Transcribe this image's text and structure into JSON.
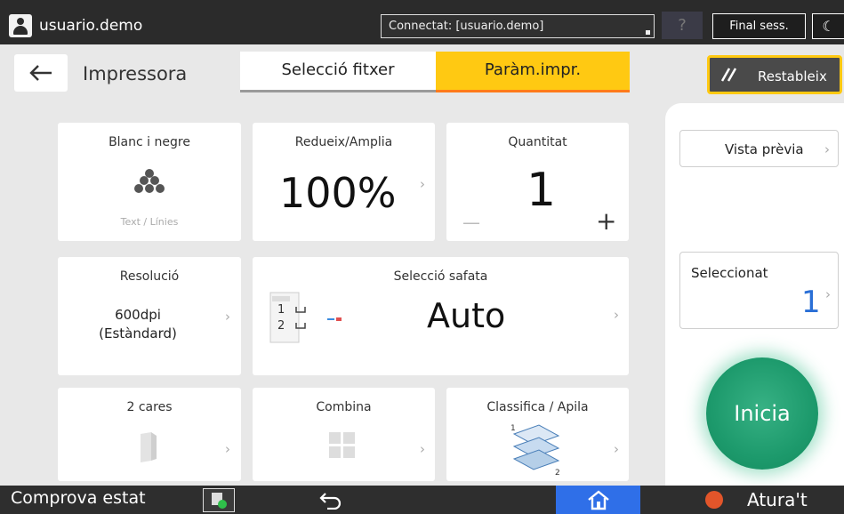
{
  "topbar": {
    "username": "usuario.demo",
    "connection": "Connectat: [usuario.demo]",
    "help": "?",
    "logout": "Final sess."
  },
  "header": {
    "title": "Impressora",
    "tabs": [
      {
        "label": "Selecció fitxer",
        "active": false
      },
      {
        "label": "Paràm.impr.",
        "active": true
      }
    ],
    "reset_label": "Restableix"
  },
  "tiles": {
    "color": {
      "title": "Blanc i negre",
      "subtitle": "Text / Línies"
    },
    "scale": {
      "title": "Redueix/Amplia",
      "value": "100%"
    },
    "quantity": {
      "title": "Quantitat",
      "value": "1",
      "minus": "—",
      "plus": "+"
    },
    "resolution": {
      "title": "Resolució",
      "line1": "600dpi",
      "line2": "(Estàndard)"
    },
    "tray": {
      "title": "Selecció safata",
      "value": "Auto",
      "tray1": "1",
      "tray2": "2"
    },
    "duplex": {
      "title": "2 cares"
    },
    "combine": {
      "title": "Combina"
    },
    "sort": {
      "title": "Classifica / Apila"
    }
  },
  "right_panel": {
    "preview": "Vista prèvia",
    "selected_label": "Seleccionat",
    "selected_count": "1",
    "start": "Inicia"
  },
  "bottombar": {
    "status_check": "Comprova estat",
    "stop": "Atura't"
  },
  "colors": {
    "accent_tab": "#ffc912",
    "tab_underline": "#ff7a1a",
    "start": "#1d9a6c",
    "home": "#2f6fe8",
    "selected_count": "#2a6fd6"
  }
}
